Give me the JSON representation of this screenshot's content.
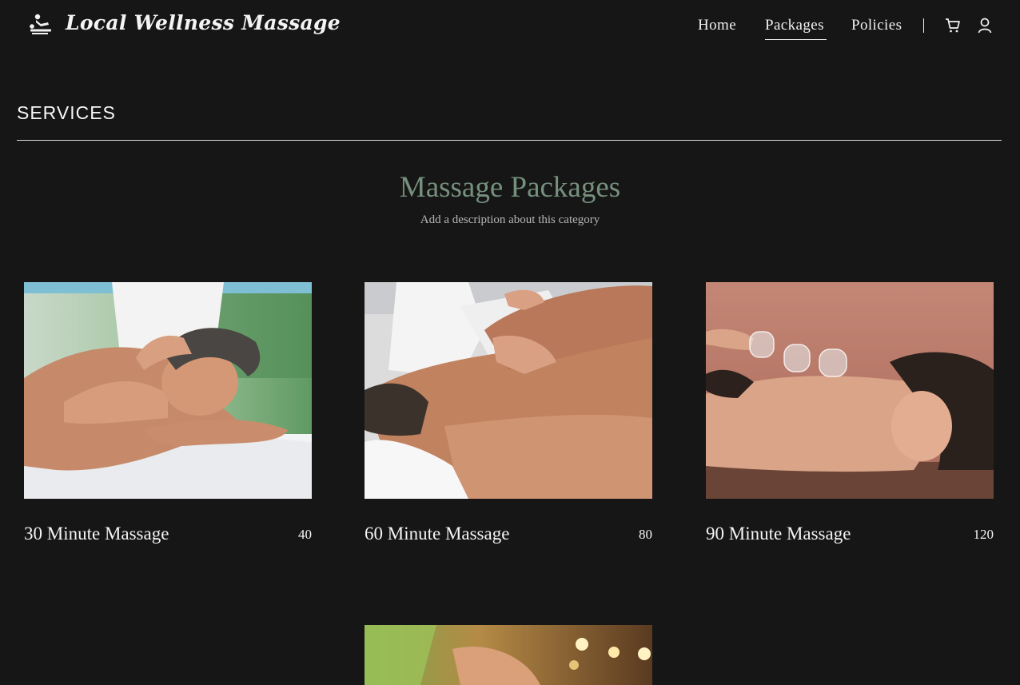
{
  "header": {
    "logo_text": "Local Wellness Massage",
    "logo_icon": "massage-person-icon",
    "nav": [
      {
        "label": "Home"
      },
      {
        "label": "Packages",
        "active": true
      },
      {
        "label": "Policies"
      }
    ],
    "cart_icon": "cart-icon",
    "account_icon": "user-icon"
  },
  "section": {
    "title": "SERVICES"
  },
  "category": {
    "title": "Massage Packages",
    "description": "Add a description about this category"
  },
  "products": [
    {
      "name": "30 Minute Massage",
      "price": "40",
      "image": "man-relaxing-shoulder-massage"
    },
    {
      "name": "60 Minute Massage",
      "price": "80",
      "image": "therapist-massaging-man-back"
    },
    {
      "name": "90 Minute Massage",
      "price": "120",
      "image": "woman-cupping-therapy"
    },
    {
      "name": "",
      "price": "",
      "image": "spa-massage-candles"
    }
  ],
  "colors": {
    "background": "#161616",
    "text": "#f2f2f2",
    "accent": "#76907e"
  }
}
